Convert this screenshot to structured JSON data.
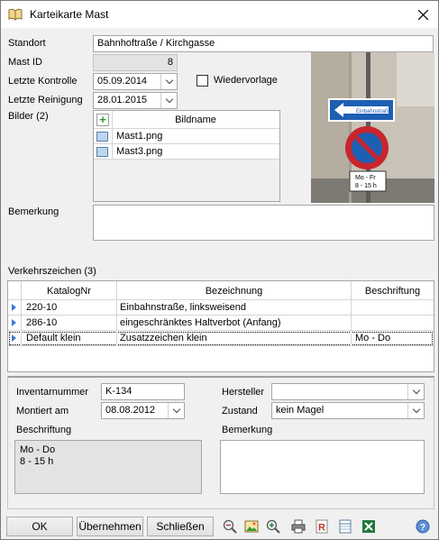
{
  "window": {
    "title": "Karteikarte Mast"
  },
  "form": {
    "standort_label": "Standort",
    "standort_value": "Bahnhoftraße / Kirchgasse",
    "mastid_label": "Mast ID",
    "mastid_value": "8",
    "kontrolle_label": "Letzte Kontrolle",
    "kontrolle_value": "05.09.2014",
    "reinigung_label": "Letzte Reinigung",
    "reinigung_value": "28.01.2015",
    "wiedervorlage_label": "Wiedervorlage",
    "bilder_label": "Bilder (2)",
    "bemerkung_label": "Bemerkung"
  },
  "bilder": {
    "header": "Bildname",
    "rows": [
      "Mast1.png",
      "Mast3.png"
    ]
  },
  "photo": {
    "sign_top_text": "Einbahnstraße",
    "sign_bottom_line1": "Mo - Fr",
    "sign_bottom_line2": "8 - 15 h"
  },
  "verkehrszeichen": {
    "label": "Verkehrszeichen (3)",
    "columns": [
      "KatalogNr",
      "Bezeichnung",
      "Beschriftung"
    ],
    "rows": [
      {
        "katalog": "220-10",
        "bezeichnung": "Einbahnstraße, linksweisend",
        "beschriftung": ""
      },
      {
        "katalog": "286-10",
        "bezeichnung": "eingeschränktes Haltverbot (Anfang)",
        "beschriftung": ""
      },
      {
        "katalog": "Default klein",
        "bezeichnung": "Zusatzzeichen klein",
        "beschriftung": "Mo - Do"
      }
    ]
  },
  "detail": {
    "inventar_label": "Inventarnummer",
    "inventar_value": "K-134",
    "montiert_label": "Montiert am",
    "montiert_value": "08.08.2012",
    "hersteller_label": "Hersteller",
    "hersteller_value": "",
    "zustand_label": "Zustand",
    "zustand_value": "kein Magel",
    "beschriftung_label": "Beschriftung",
    "beschriftung_line1": "Mo - Do",
    "beschriftung_line2": "8 - 15 h",
    "bemerkung_label": "Bemerkung"
  },
  "buttons": {
    "ok": "OK",
    "uebernehmen": "Übernehmen",
    "schliessen": "Schließen"
  },
  "toolbar": {
    "icons": [
      "zoom-out-icon",
      "image-icon",
      "zoom-in-icon",
      "print-icon",
      "report-icon",
      "table-icon",
      "excel-icon",
      "help-icon"
    ]
  }
}
